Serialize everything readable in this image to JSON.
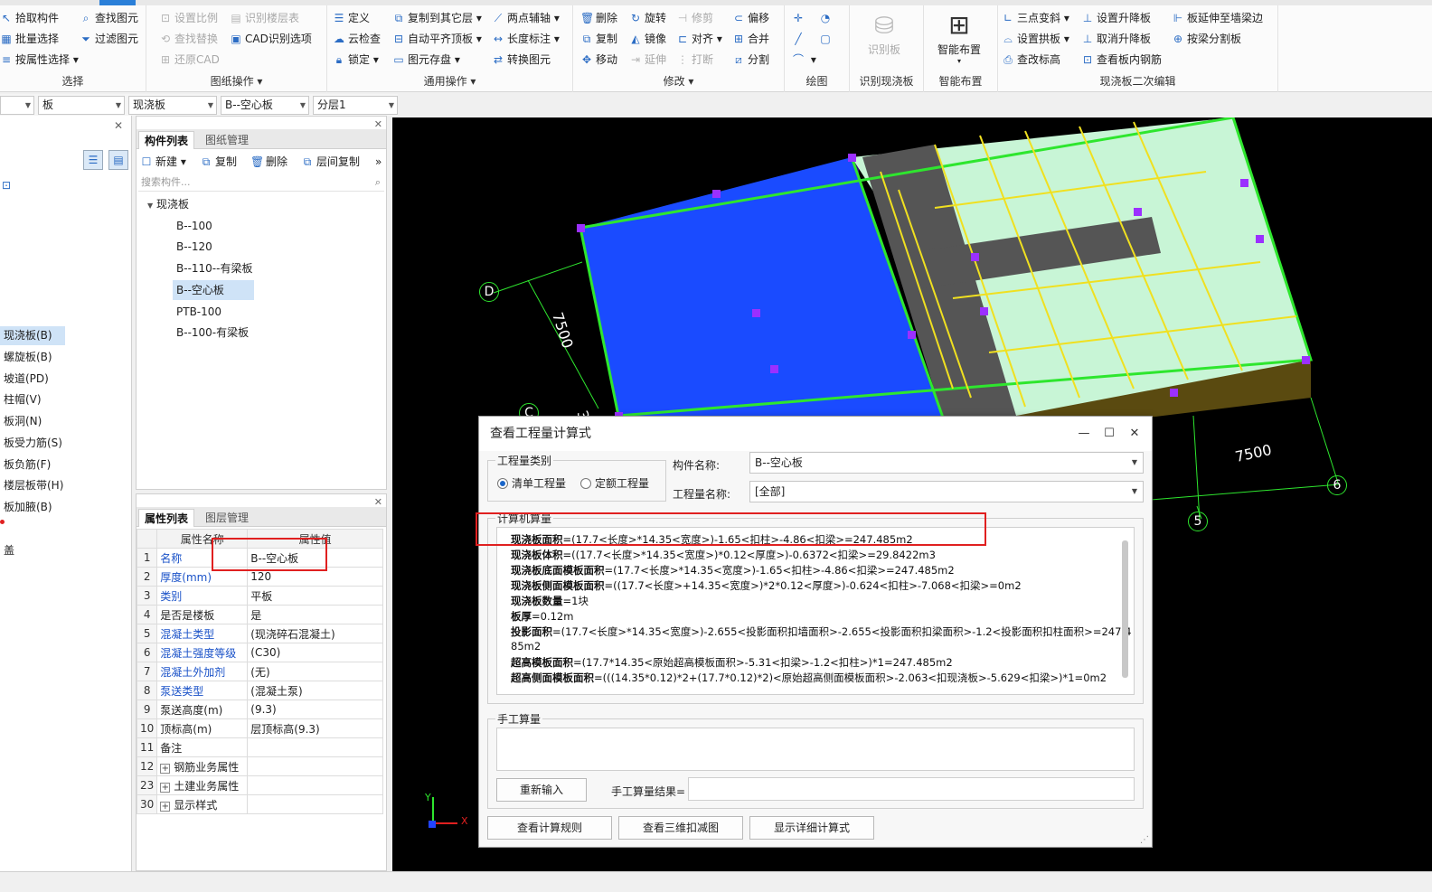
{
  "ribbon": {
    "groups": {
      "select": {
        "title": "选择",
        "items": [
          "拾取构件",
          "批量选择",
          "按属性选择",
          "查找图元",
          "过滤图元"
        ]
      },
      "drawing_ops": {
        "title": "图纸操作",
        "items": [
          "设置比例",
          "识别楼层表",
          "查找替换",
          "CAD识别选项",
          "还原CAD"
        ]
      },
      "common_ops": {
        "title": "通用操作",
        "items": [
          "定义",
          "复制到其它层",
          "两点辅轴",
          "云检查",
          "自动平齐顶板",
          "长度标注",
          "锁定",
          "图元存盘",
          "转换图元"
        ]
      },
      "modify": {
        "title": "修改",
        "items": [
          "删除",
          "旋转",
          "修剪",
          "偏移",
          "复制",
          "镜像",
          "对齐",
          "合并",
          "移动",
          "延伸",
          "打断",
          "分割"
        ]
      },
      "draw": {
        "title": "绘图"
      },
      "recognize": {
        "title": "识别现浇板",
        "button": "识别板"
      },
      "smart": {
        "title": "智能布置",
        "button": "智能布置"
      },
      "secondary": {
        "title": "现浇板二次编辑",
        "items": [
          "三点变斜",
          "设置升降板",
          "板延伸至墙梁边",
          "设置拱板",
          "取消升降板",
          "按梁分割板",
          "查改标高",
          "查看板内钢筋"
        ]
      }
    }
  },
  "filters": {
    "combo1": "",
    "combo2": "板",
    "combo3": "现浇板",
    "combo4": "B--空心板",
    "combo5": "分层1"
  },
  "leftnav": {
    "items": [
      "现浇板(B)",
      "螺旋板(B)",
      "坡道(PD)",
      "柱帽(V)",
      "板洞(N)",
      "板受力筋(S)",
      "板负筋(F)",
      "楼层板带(H)",
      "板加腋(B)",
      "盖"
    ]
  },
  "component_panel": {
    "tabs": [
      "构件列表",
      "图纸管理"
    ],
    "toolbar": [
      "新建",
      "复制",
      "删除",
      "层间复制"
    ],
    "search_placeholder": "搜索构件...",
    "tree_root": "现浇板",
    "tree_items": [
      "B--100",
      "B--120",
      "B--110--有梁板",
      "B--空心板",
      "PTB-100",
      "B--100-有梁板"
    ]
  },
  "property_panel": {
    "tabs": [
      "属性列表",
      "图层管理"
    ],
    "headers": [
      "属性名称",
      "属性值"
    ],
    "rows": [
      {
        "idx": "1",
        "name": "名称",
        "value": "B--空心板"
      },
      {
        "idx": "2",
        "name": "厚度(mm)",
        "value": "120"
      },
      {
        "idx": "3",
        "name": "类别",
        "value": "平板"
      },
      {
        "idx": "4",
        "name": "是否是楼板",
        "value": "是"
      },
      {
        "idx": "5",
        "name": "混凝土类型",
        "value": "(现浇碎石混凝土)"
      },
      {
        "idx": "6",
        "name": "混凝土强度等级",
        "value": "(C30)"
      },
      {
        "idx": "7",
        "name": "混凝土外加剂",
        "value": "(无)"
      },
      {
        "idx": "8",
        "name": "泵送类型",
        "value": "(混凝土泵)"
      },
      {
        "idx": "9",
        "name": "泵送高度(m)",
        "value": "(9.3)"
      },
      {
        "idx": "10",
        "name": "顶标高(m)",
        "value": "层顶标高(9.3)"
      },
      {
        "idx": "11",
        "name": "备注",
        "value": ""
      },
      {
        "idx": "12",
        "name": "钢筋业务属性",
        "value": ""
      },
      {
        "idx": "23",
        "name": "土建业务属性",
        "value": ""
      },
      {
        "idx": "30",
        "name": "显示样式",
        "value": ""
      }
    ]
  },
  "viewport": {
    "axis_labels": [
      "D",
      "C",
      "5",
      "6"
    ],
    "dimensions": [
      "7500",
      "7500",
      "3"
    ],
    "axis_x": "X",
    "axis_y": "Y"
  },
  "dialog": {
    "title": "查看工程量计算式",
    "qty_category_label": "工程量类别",
    "radio_list": "清单工程量",
    "radio_quota": "定额工程量",
    "component_name_label": "构件名称:",
    "component_name_value": "B--空心板",
    "qty_name_label": "工程量名称:",
    "qty_name_value": "[全部]",
    "calc_label": "计算机算量",
    "calc_lines": [
      {
        "key": "现浇板面积",
        "expr": "=(17.7<长度>*14.35<宽度>)-1.65<扣柱>-4.86<扣梁>=247.485m2"
      },
      {
        "key": "现浇板体积",
        "expr": "=((17.7<长度>*14.35<宽度>)*0.12<厚度>)-0.6372<扣梁>=29.8422m3"
      },
      {
        "key": "现浇板底面模板面积",
        "expr": "=(17.7<长度>*14.35<宽度>)-1.65<扣柱>-4.86<扣梁>=247.485m2"
      },
      {
        "key": "现浇板侧面模板面积",
        "expr": "=((17.7<长度>+14.35<宽度>)*2*0.12<厚度>)-0.624<扣柱>-7.068<扣梁>=0m2"
      },
      {
        "key": "现浇板数量",
        "expr": "=1块"
      },
      {
        "key": "板厚",
        "expr": "=0.12m"
      },
      {
        "key": "投影面积",
        "expr": "=(17.7<长度>*14.35<宽度>)-2.655<投影面积扣墙面积>-2.655<投影面积扣梁面积>-1.2<投影面积扣柱面积>=247.4"
      },
      {
        "key": "",
        "expr": "85m2"
      },
      {
        "key": "超高模板面积",
        "expr": "=(17.7*14.35<原始超高模板面积>-5.31<扣梁>-1.2<扣柱>)*1=247.485m2"
      },
      {
        "key": "超高侧面模板面积",
        "expr": "=(((14.35*0.12)*2+(17.7*0.12)*2)<原始超高侧面模板面积>-2.063<扣现浇板>-5.629<扣梁>)*1=0m2"
      }
    ],
    "manual_label": "手工算量",
    "reenter_button": "重新输入",
    "manual_result_label": "手工算量结果=",
    "buttons": [
      "查看计算规则",
      "查看三维扣减图",
      "显示详细计算式"
    ]
  },
  "colors": {
    "slab_blue": "#1a4bff",
    "slab_green": "#c8f5d6",
    "beam_gray": "#555555",
    "rebar_yellow": "#f0e020",
    "highlight_red": "#e02020",
    "selection_bg": "#cfe3f7"
  }
}
